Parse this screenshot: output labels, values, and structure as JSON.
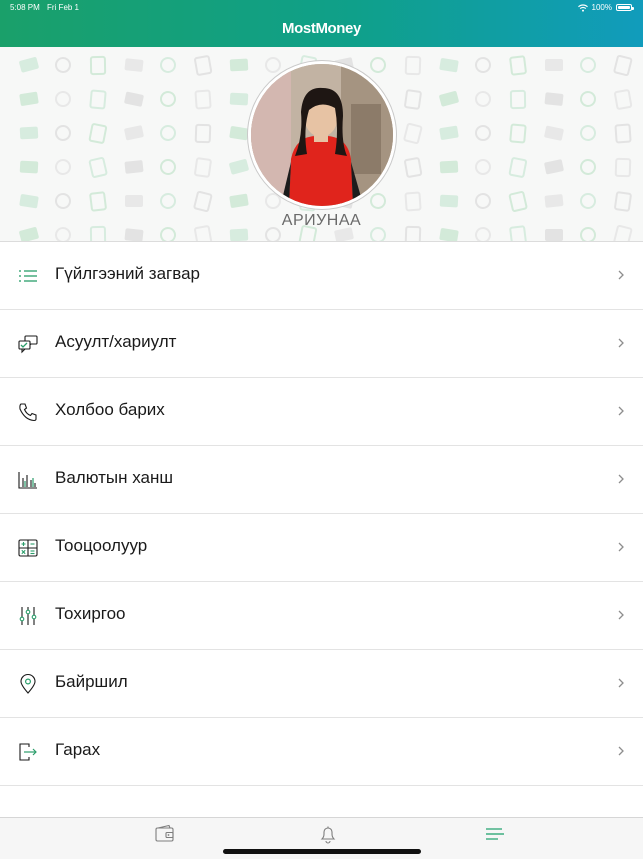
{
  "status_bar": {
    "time": "5:08 PM",
    "date": "Fri Feb 1",
    "battery": "100%"
  },
  "header": {
    "title": "MostMoney"
  },
  "profile": {
    "name": "АРИУНАА"
  },
  "menu": {
    "items": [
      {
        "label": "Гүйлгээний загвар",
        "icon": "list-icon"
      },
      {
        "label": "Асуулт/хариулт",
        "icon": "chat-icon"
      },
      {
        "label": "Холбоо барих",
        "icon": "phone-icon"
      },
      {
        "label": "Валютын ханш",
        "icon": "bar-chart-icon"
      },
      {
        "label": "Тооцоолуур",
        "icon": "calculator-icon"
      },
      {
        "label": "Тохиргоо",
        "icon": "sliders-icon"
      },
      {
        "label": "Байршил",
        "icon": "location-pin-icon"
      },
      {
        "label": "Гарах",
        "icon": "logout-icon"
      }
    ]
  },
  "tabbar": {
    "tabs": [
      {
        "icon": "wallet-icon",
        "active": false
      },
      {
        "icon": "bell-icon",
        "active": false
      },
      {
        "icon": "menu-icon",
        "active": true
      }
    ]
  },
  "colors": {
    "accent": "#1aa06a",
    "header_start": "#1aa06a",
    "header_end": "#119cbc",
    "avatar_dress": "#e0241c"
  }
}
